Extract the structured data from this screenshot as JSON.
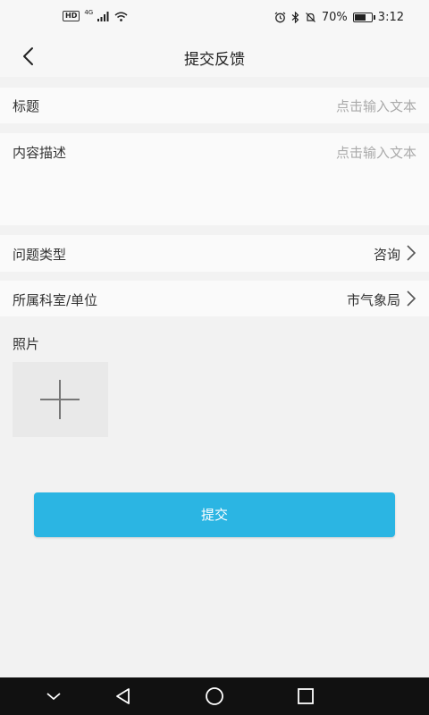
{
  "status_bar": {
    "hd_badge": "HD",
    "network": "4G",
    "battery_percent": "70%",
    "battery_level": 0.7,
    "time": "3:12"
  },
  "header": {
    "title": "提交反馈",
    "back_icon": "chevron-left-icon"
  },
  "form": {
    "title_label": "标题",
    "title_placeholder": "点击输入文本",
    "content_label": "内容描述",
    "content_placeholder": "点击输入文本",
    "type_label": "问题类型",
    "type_value": "咨询",
    "dept_label": "所属科室/单位",
    "dept_value": "市气象局",
    "photo_label": "照片",
    "photo_add_icon": "plus-icon"
  },
  "submit_label": "提交",
  "colors": {
    "accent": "#2bb5e3",
    "background": "#f2f2f2",
    "nav_bar": "#111111"
  }
}
